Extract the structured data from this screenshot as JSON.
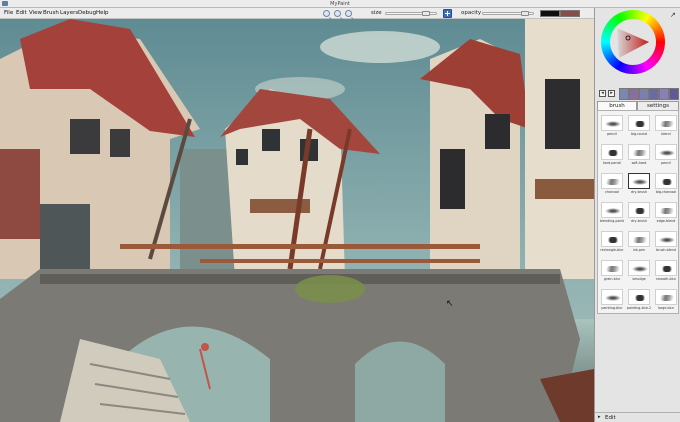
{
  "window": {
    "title": "MyPaint"
  },
  "menu": [
    "File",
    "Edit",
    "View",
    "Brush",
    "Layers",
    "Debug",
    "Help"
  ],
  "toolbar": {
    "size_label": "size",
    "opacity_label": "opacity",
    "size_value": 0.85,
    "opacity_value": 0.9,
    "primary_color": "#0f0f0f",
    "secondary_color": "#8a4d45"
  },
  "sidepanel": {
    "tabs": [
      "brush",
      "settings"
    ],
    "active_tab": "brush",
    "color_history": [
      "#7c86b2",
      "#8a6f9e",
      "#7b7fae",
      "#6b6aa3",
      "#8a80b8",
      "#5d5a95"
    ],
    "brushes": [
      "pencil",
      "big-round",
      "blend",
      "hard-pencil",
      "soft-hard",
      "pencil",
      "charcoal",
      "dry-brush",
      "big-charcoal",
      "blending-paint",
      "dry-brush",
      "edge-blend",
      "rectangle-blur",
      "ink-pen",
      "brush-blend",
      "grain-blur",
      "smudge",
      "smooth-blur",
      "painting-blur",
      "painting-blur-2",
      "large-blur"
    ],
    "selected_brush_index": 7,
    "edit_label": "Edit"
  }
}
